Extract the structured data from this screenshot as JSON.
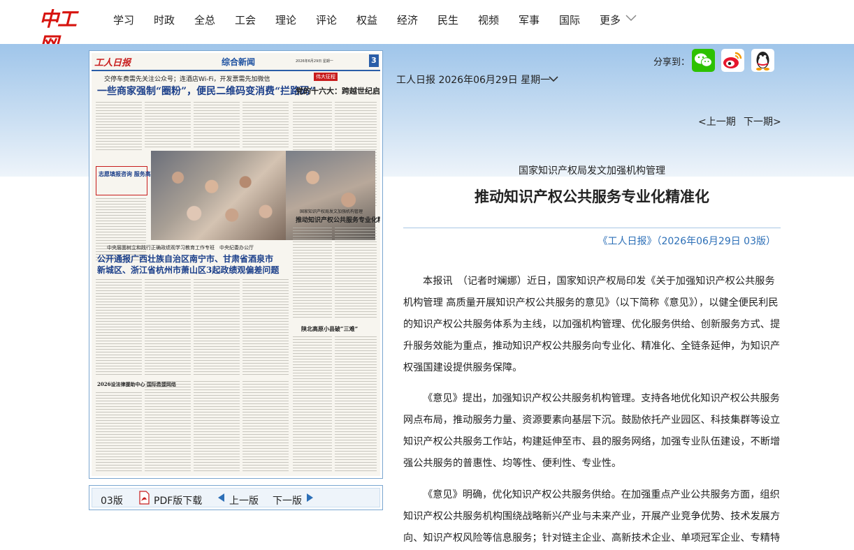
{
  "site": {
    "logo_text": "中工网",
    "nav": [
      "学习",
      "时政",
      "全总",
      "工会",
      "理论",
      "评论",
      "权益",
      "经济",
      "民生",
      "视频",
      "军事",
      "国际",
      "更多"
    ]
  },
  "paper": {
    "brand": "工人日报",
    "section": "综合新闻",
    "page_number": "3",
    "date_line": "2026年6月29日 星期一",
    "top_subhead": "交停车费需先关注公众号；连酒店Wi-Fi，开发票需先加微信",
    "top_headline": "一些商家强制“圈粉”，便民二维码变消费“拦路码”",
    "right_tag": "伟大征程",
    "right_headline": "党的十六大：跨越世纪启新程",
    "box_headline": "志愿填报咨询 服务高考考生",
    "mid_kicker": "国家知识产权局发文加强机构管理",
    "mid_headline": "推动知识产权公共服务专业化精准化",
    "lower_subhead": "中央层面树立和践行正确政绩观学习教育工作专班　中央纪委办公厅",
    "lower_headline_1": "公开通报广西壮族自治区南宁市、甘肃省酒泉市",
    "lower_headline_2": "新城区、浙江省杭州市萧山区3起政绩观偏差问题",
    "left_box_headline": "2026设法律援助中心 国际救援网络",
    "right_lower_headline": "陕北高原小县破“三难”"
  },
  "pager": {
    "current": "03版",
    "pdf_label": "PDF版下载",
    "prev": "上一版",
    "next": "下一版"
  },
  "share": {
    "label": "分享到：",
    "targets": [
      "wechat",
      "weibo",
      "qq"
    ]
  },
  "edition": {
    "date": "工人日报 2026年06月29日 星期一",
    "prev_issue": "<上一期",
    "next_issue": "下一期>"
  },
  "article": {
    "kicker": "国家知识产权局发文加强机构管理",
    "headline": "推动知识产权公共服务专业化精准化",
    "source": "《工人日报》（2026年06月29日 03版）",
    "paragraphs": [
      "本报讯　（记者时斓娜）近日，国家知识产权局印发《关于加强知识产权公共服务机构管理 高质量开展知识产权公共服务的意见》（以下简称《意见》），以健全便民利民的知识产权公共服务体系为主线，以加强机构管理、优化服务供给、创新服务方式、提升服务效能为重点，推动知识产权公共服务向专业化、精准化、全链条延伸，为知识产权强国建设提供服务保障。",
      "《意见》提出，加强知识产权公共服务机构管理。支持各地优化知识产权公共服务网点布局，推动服务力量、资源要素向基层下沉。鼓励依托产业园区、科技集群等设立知识产权公共服务工作站，构建延伸至市、县的服务网络，加强专业队伍建设，不断增强公共服务的普惠性、均等性、便利性、专业性。",
      "《意见》明确，优化知识产权公共服务供给。在加强重点产业公共服务方面，组织知识产权公共服务机构围绕战略新兴产业与未来产业，开展产业竞争优势、技术发展方向、知识产权风险等信息服务；针对链主企业、高新技术企业、单项冠军企业、专精特"
    ]
  },
  "colors": {
    "brand_red": "#d7140f",
    "link_blue": "#2c6fb7",
    "band_blue": "#9fc5ea",
    "wechat_green": "#2dc100",
    "weibo_red": "#e6162d",
    "qq_blue": "#12b7f5"
  }
}
